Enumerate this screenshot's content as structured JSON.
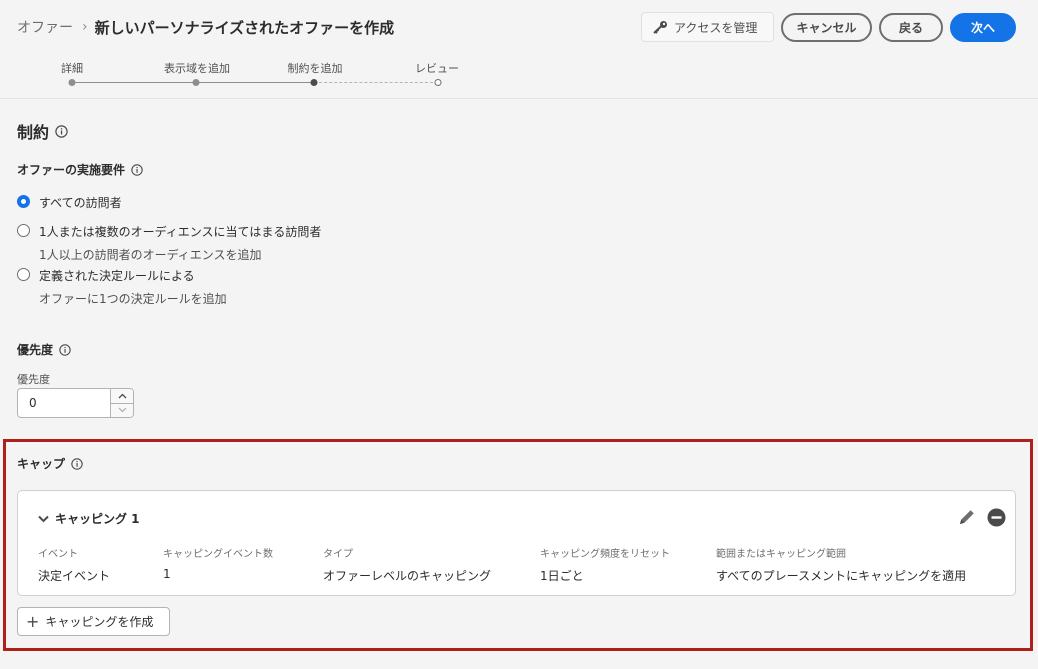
{
  "header": {
    "breadcrumb_parent": "オファー",
    "breadcrumb_separator": "›",
    "title": "新しいパーソナライズされたオファーを作成",
    "access_button": "アクセスを管理",
    "cancel_button": "キャンセル",
    "back_button": "戻る",
    "next_button": "次へ"
  },
  "steps": [
    {
      "label": "詳細",
      "state": "done"
    },
    {
      "label": "表示域を追加",
      "state": "done"
    },
    {
      "label": "制約を追加",
      "state": "current"
    },
    {
      "label": "レビュー",
      "state": "upcoming"
    }
  ],
  "constraints": {
    "title": "制約",
    "eligibility": {
      "title": "オファーの実施要件",
      "options": [
        {
          "label": "すべての訪問者",
          "sub": "",
          "selected": true
        },
        {
          "label": "1人または複数のオーディエンスに当てはまる訪問者",
          "sub": "1人以上の訪問者のオーディエンスを追加",
          "selected": false
        },
        {
          "label": "定義された決定ルールによる",
          "sub": "オファーに1つの決定ルールを追加",
          "selected": false
        }
      ]
    }
  },
  "priority": {
    "title": "優先度",
    "field_label": "優先度",
    "value": "0"
  },
  "capping": {
    "title": "キャップ",
    "card": {
      "title": "キャッピング 1",
      "columns": [
        {
          "header": "イベント",
          "value": "決定イベント"
        },
        {
          "header": "キャッピングイベント数",
          "value": "1"
        },
        {
          "header": "タイプ",
          "value": "オファーレベルのキャッピング"
        },
        {
          "header": "キャッピング頻度をリセット",
          "value": "1日ごと"
        },
        {
          "header": "範囲またはキャッピング範囲",
          "value": "すべてのプレースメントにキャッピングを適用"
        }
      ]
    },
    "create_button": "キャッピングを作成"
  },
  "colors": {
    "accent": "#1473e6",
    "highlight_border": "#b0201b"
  }
}
